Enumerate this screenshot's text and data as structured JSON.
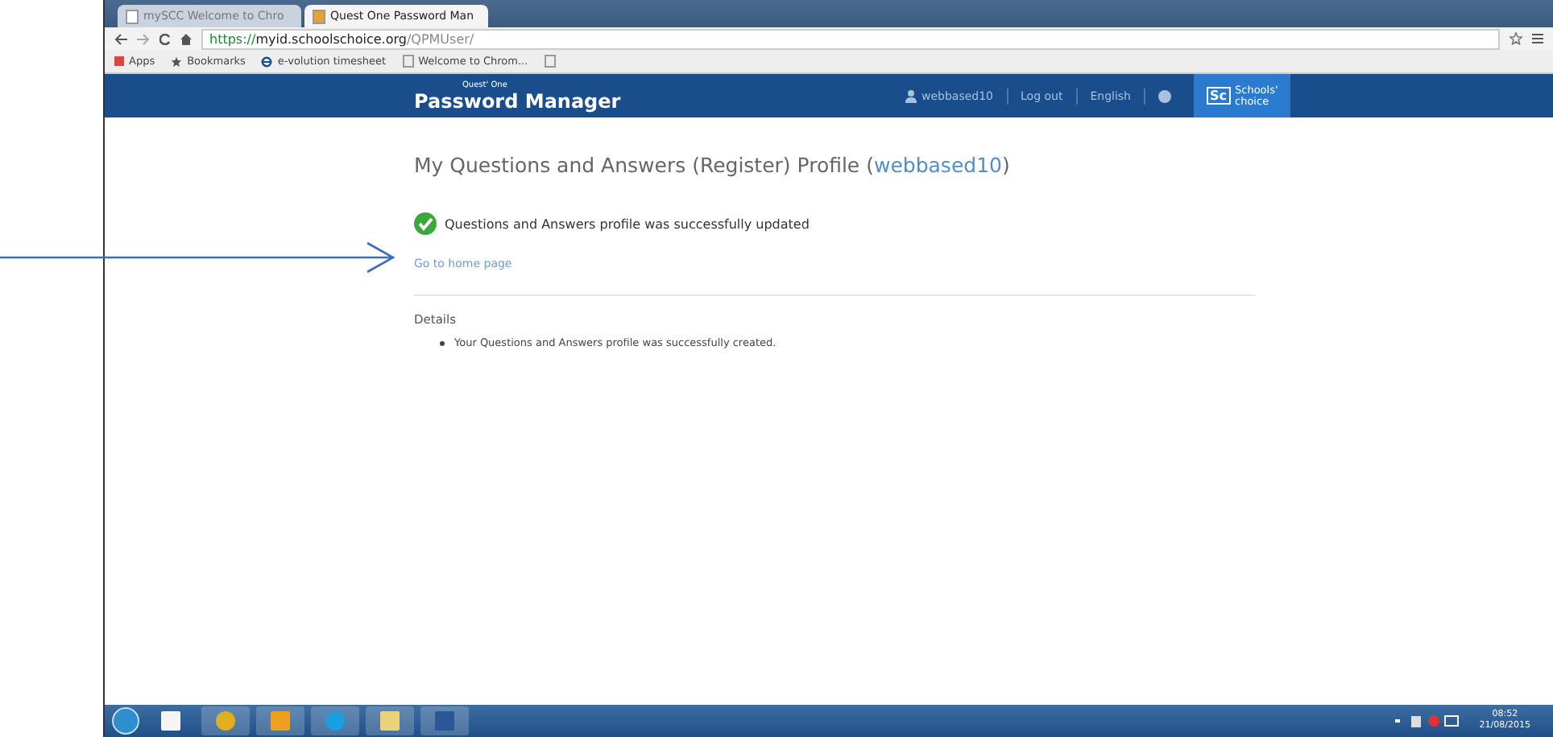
{
  "browser": {
    "tabs": [
      {
        "label": "mySCC Welcome to Chro",
        "selected": false
      },
      {
        "label": "Quest One Password Man",
        "selected": true
      }
    ],
    "address": {
      "scheme": "https://",
      "host": "myid.schoolschoice.org",
      "path": "/QPMUser/"
    },
    "bookmarks": [
      {
        "kind": "apps",
        "label": "Apps"
      },
      {
        "kind": "star",
        "label": "Bookmarks"
      },
      {
        "kind": "ie",
        "label": "e-volution timesheet"
      },
      {
        "kind": "page",
        "label": "Welcome to Chrom..."
      },
      {
        "kind": "page"
      }
    ]
  },
  "header": {
    "brand_small": "Quest' One",
    "brand": "Password Manager",
    "user": "webbased10",
    "links": [
      "Log out",
      "English"
    ],
    "logo_mark": "Sc",
    "logo_lines": [
      "Schools'",
      "choice"
    ]
  },
  "page": {
    "title": "My Questions and Answers (Register) Profile (",
    "title_user": "webbased10",
    "title_end": ")",
    "message": "Questions and Answers profile was successfully updated",
    "home_link": "Go to home page",
    "details_heading": "Details",
    "details": [
      "Your Questions and Answers profile was successfully created."
    ]
  },
  "taskbar": {
    "apps": [
      {
        "kind": "file"
      },
      {
        "kind": "chrome"
      },
      {
        "kind": "outlook"
      },
      {
        "kind": "skype"
      },
      {
        "kind": "folder"
      },
      {
        "kind": "word"
      }
    ],
    "time": "08:52",
    "date": "21/08/2015"
  }
}
